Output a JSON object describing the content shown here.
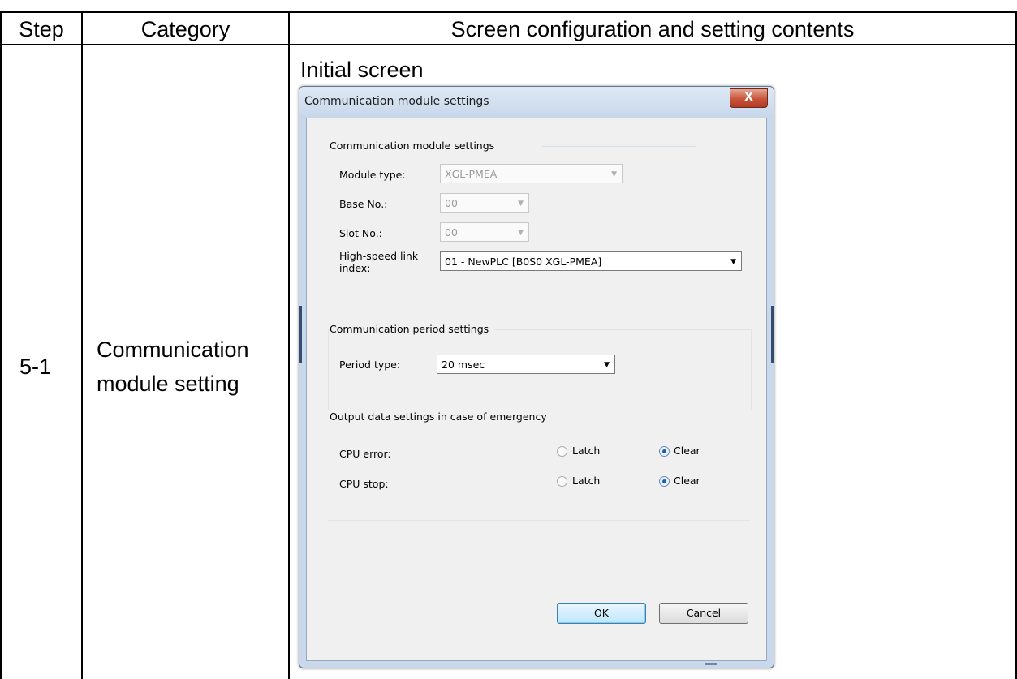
{
  "table": {
    "headers": {
      "step": "Step",
      "category": "Category",
      "contents": "Screen configuration and setting contents"
    },
    "row": {
      "step": "5-1",
      "category_line1": "Communication",
      "category_line2": "module setting",
      "caption": "Initial screen"
    }
  },
  "dialog": {
    "title": "Communication module settings",
    "close_label": "X",
    "module_group": {
      "title": "Communication module settings",
      "module_type_label": "Module type:",
      "module_type_value": "XGL-PMEA",
      "base_no_label": "Base No.:",
      "base_no_value": "00",
      "slot_no_label": "Slot No.:",
      "slot_no_value": "00",
      "hs_link_label_line1": "High-speed link",
      "hs_link_label_line2": "index:",
      "hs_link_value": "01 - NewPLC [B0S0 XGL-PMEA]"
    },
    "period_group": {
      "title": "Communication period settings",
      "period_type_label": "Period type:",
      "period_type_value": "20 msec"
    },
    "emergency_group": {
      "title": "Output data settings in case of emergency",
      "rows": [
        {
          "label": "CPU error:",
          "option1": "Latch",
          "option2": "Clear",
          "selected": "Clear"
        },
        {
          "label": "CPU stop:",
          "option1": "Latch",
          "option2": "Clear",
          "selected": "Clear"
        }
      ]
    },
    "ok_label": "OK",
    "cancel_label": "Cancel"
  }
}
